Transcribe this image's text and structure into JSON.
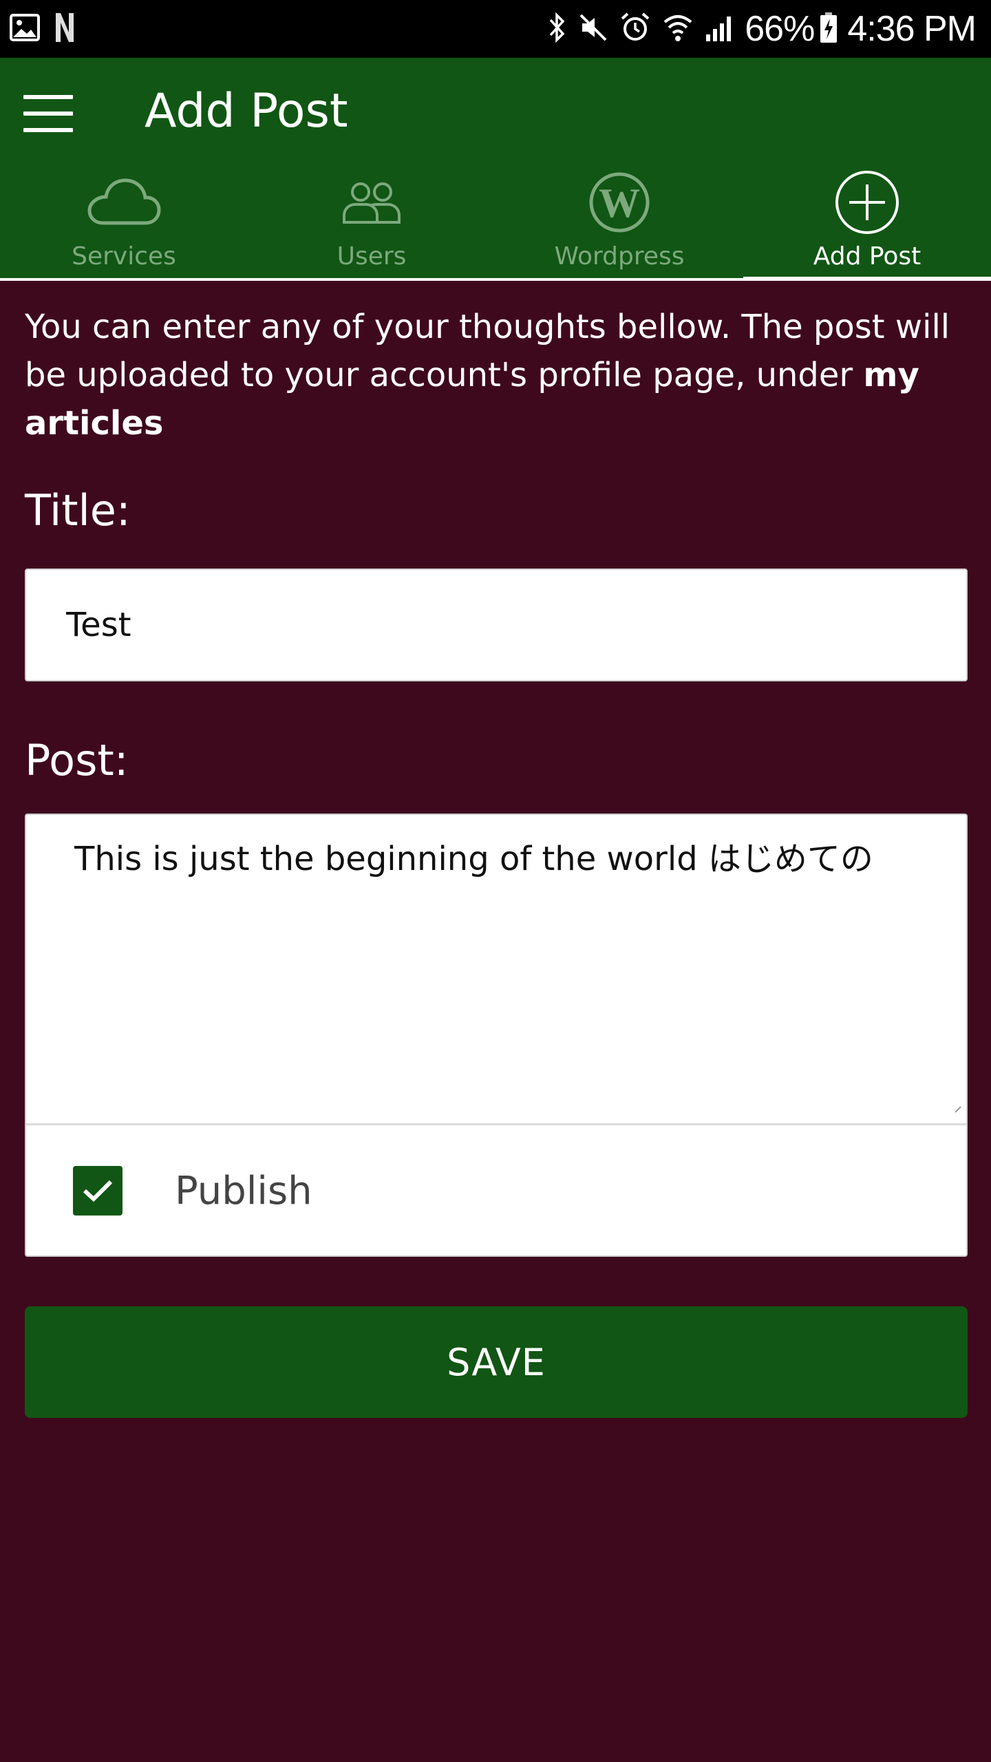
{
  "status_bar": {
    "battery": "66%",
    "time": "4:36 PM",
    "left_icons": [
      "image-icon",
      "netflix-icon"
    ],
    "right_icons": [
      "bluetooth-icon",
      "mute-icon",
      "alarm-icon",
      "wifi-icon",
      "signal-icon",
      "battery-charging-icon"
    ]
  },
  "app_bar": {
    "title": "Add Post",
    "color": "#115614"
  },
  "tabs": [
    {
      "label": "Services",
      "icon": "cloud-icon",
      "active": false
    },
    {
      "label": "Users",
      "icon": "users-icon",
      "active": false
    },
    {
      "label": "Wordpress",
      "icon": "wordpress-icon",
      "active": false
    },
    {
      "label": "Add Post",
      "icon": "add-circle-icon",
      "active": true
    }
  ],
  "intro": {
    "text": "You can enter any of your thoughts bellow. The post will be uploaded to your account's profile page, under ",
    "bold": "my articles"
  },
  "form": {
    "title_label": "Title:",
    "title_value": "Test",
    "post_label": "Post:",
    "post_value": "This is just the beginning of the world はじめての",
    "publish_label": "Publish",
    "publish_checked": true,
    "save_label": "SAVE"
  },
  "colors": {
    "background": "#3f091d",
    "accent": "#115614",
    "inactive_tab": "#7da97d"
  }
}
